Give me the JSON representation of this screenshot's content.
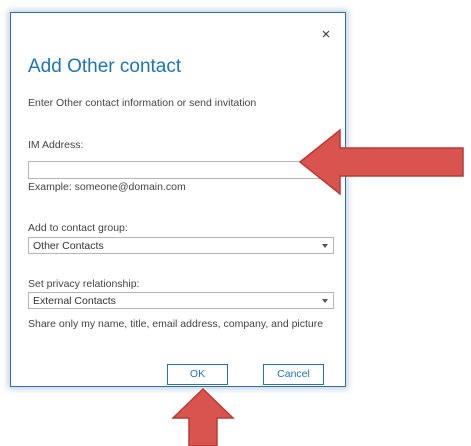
{
  "dialog": {
    "title": "Add Other contact",
    "close_icon": "×",
    "intro": "Enter Other contact information or send invitation",
    "im_label": "IM Address:",
    "im_value": "",
    "im_example": "Example: someone@domain.com",
    "group_label": "Add to contact group:",
    "group_selected": "Other Contacts",
    "privacy_label": "Set privacy relationship:",
    "privacy_selected": "External Contacts",
    "share_text": "Share only my name, title, email address, company, and picture",
    "ok_label": "OK",
    "cancel_label": "Cancel"
  },
  "colors": {
    "accent": "#1f74b8",
    "arrow_fill": "#d9534f",
    "arrow_stroke": "#b83a36"
  },
  "icons": {
    "close": "close-icon",
    "dropdown": "chevron-down-icon",
    "annotation_right": "arrow-left-annotation-icon",
    "annotation_up": "arrow-up-annotation-icon"
  }
}
